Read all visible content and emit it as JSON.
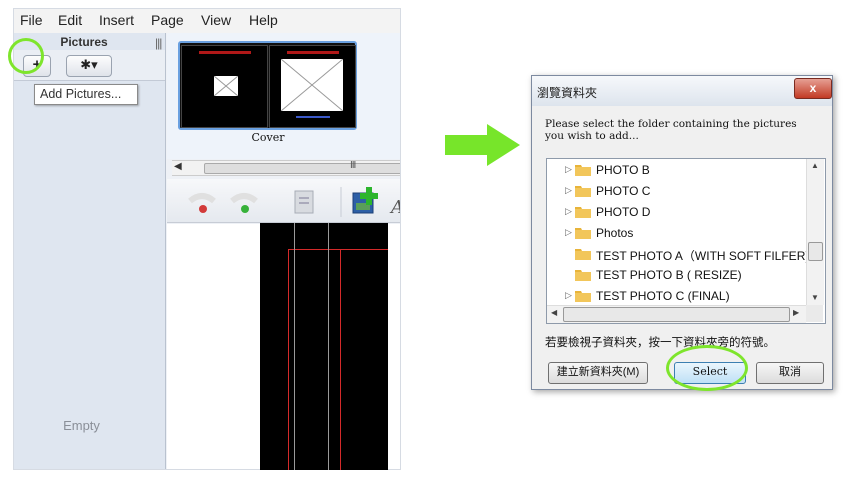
{
  "app": {
    "menu": [
      "File",
      "Edit",
      "Insert",
      "Page",
      "View",
      "Help"
    ],
    "pictures_panel": {
      "title": "Pictures",
      "add_button": "+",
      "gear_button": "✱▾",
      "tooltip": "Add Pictures...",
      "empty_label": "Empty"
    },
    "pages": {
      "cover_label": "Cover"
    },
    "hscroll_grip": "III"
  },
  "dialog": {
    "title": "瀏覽資料夾",
    "close": "x",
    "instruction": "Please select the folder containing the pictures you wish to add...",
    "folders": [
      {
        "label": "PHOTO B",
        "expandable": true
      },
      {
        "label": "PHOTO C",
        "expandable": true
      },
      {
        "label": "PHOTO D",
        "expandable": true
      },
      {
        "label": "Photos",
        "expandable": true
      },
      {
        "label": "TEST PHOTO A（WITH SOFT FILFER)",
        "expandable": false
      },
      {
        "label": "TEST PHOTO B ( RESIZE)",
        "expandable": false
      },
      {
        "label": "TEST PHOTO C (FINAL)",
        "expandable": true
      }
    ],
    "subfolder_hint": "若要檢視子資料夾，按一下資料夾旁的符號。",
    "buttons": {
      "new_folder": "建立新資料夾(M)",
      "select": "Select",
      "cancel": "取消"
    }
  },
  "colors": {
    "highlight": "#7ee52c",
    "arrow": "#77e52a",
    "folder": "#e8b43a"
  }
}
